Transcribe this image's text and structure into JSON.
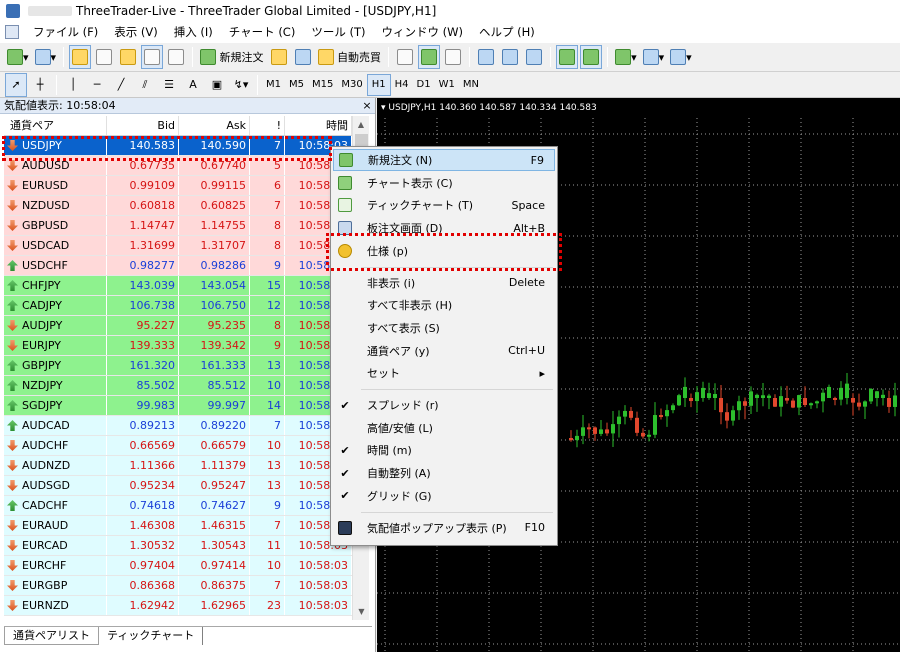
{
  "window": {
    "title": "ThreeTrader-Live - ThreeTrader Global Limited - [USDJPY,H1]"
  },
  "menu": [
    "ファイル (F)",
    "表示 (V)",
    "挿入 (I)",
    "チャート (C)",
    "ツール (T)",
    "ウィンドウ (W)",
    "ヘルプ (H)"
  ],
  "toolbar1": {
    "new_order": "新規注文",
    "auto_trade": "自動売買"
  },
  "toolbar2": {
    "text_tool": "A",
    "timeframes": [
      "M1",
      "M5",
      "M15",
      "M30",
      "H1",
      "H4",
      "D1",
      "W1",
      "MN"
    ],
    "active_timeframe": "H1"
  },
  "market_watch": {
    "header": "気配値表示: 10:58:04",
    "columns": {
      "symbol": "通貨ペア",
      "bid": "Bid",
      "ask": "Ask",
      "spread": "!",
      "time": "時間"
    },
    "rows": [
      {
        "symbol": "USDJPY",
        "bid": "140.583",
        "ask": "140.590",
        "spread": "7",
        "time": "10:58:03",
        "dir": "down",
        "bg": "sel",
        "vc": "blue"
      },
      {
        "symbol": "AUDUSD",
        "bid": "0.67735",
        "ask": "0.67740",
        "spread": "5",
        "time": "10:58:03",
        "dir": "down",
        "bg": "red",
        "vc": "red"
      },
      {
        "symbol": "EURUSD",
        "bid": "0.99109",
        "ask": "0.99115",
        "spread": "6",
        "time": "10:58:03",
        "dir": "down",
        "bg": "red",
        "vc": "red"
      },
      {
        "symbol": "NZDUSD",
        "bid": "0.60818",
        "ask": "0.60825",
        "spread": "7",
        "time": "10:58:03",
        "dir": "down",
        "bg": "red",
        "vc": "red"
      },
      {
        "symbol": "GBPUSD",
        "bid": "1.14747",
        "ask": "1.14755",
        "spread": "8",
        "time": "10:58:03",
        "dir": "down",
        "bg": "red",
        "vc": "red"
      },
      {
        "symbol": "USDCAD",
        "bid": "1.31699",
        "ask": "1.31707",
        "spread": "8",
        "time": "10:58:03",
        "dir": "down",
        "bg": "red",
        "vc": "red"
      },
      {
        "symbol": "USDCHF",
        "bid": "0.98277",
        "ask": "0.98286",
        "spread": "9",
        "time": "10:58:03",
        "dir": "up",
        "bg": "red",
        "vc": "blue"
      },
      {
        "symbol": "CHFJPY",
        "bid": "143.039",
        "ask": "143.054",
        "spread": "15",
        "time": "10:58:03",
        "dir": "up",
        "bg": "green",
        "vc": "blue"
      },
      {
        "symbol": "CADJPY",
        "bid": "106.738",
        "ask": "106.750",
        "spread": "12",
        "time": "10:58:03",
        "dir": "up",
        "bg": "green",
        "vc": "blue"
      },
      {
        "symbol": "AUDJPY",
        "bid": "95.227",
        "ask": "95.235",
        "spread": "8",
        "time": "10:58:03",
        "dir": "down",
        "bg": "green",
        "vc": "red"
      },
      {
        "symbol": "EURJPY",
        "bid": "139.333",
        "ask": "139.342",
        "spread": "9",
        "time": "10:58:03",
        "dir": "down",
        "bg": "green",
        "vc": "red"
      },
      {
        "symbol": "GBPJPY",
        "bid": "161.320",
        "ask": "161.333",
        "spread": "13",
        "time": "10:58:03",
        "dir": "up",
        "bg": "green",
        "vc": "blue"
      },
      {
        "symbol": "NZDJPY",
        "bid": "85.502",
        "ask": "85.512",
        "spread": "10",
        "time": "10:58:03",
        "dir": "up",
        "bg": "green",
        "vc": "blue"
      },
      {
        "symbol": "SGDJPY",
        "bid": "99.983",
        "ask": "99.997",
        "spread": "14",
        "time": "10:58:03",
        "dir": "up",
        "bg": "green",
        "vc": "blue"
      },
      {
        "symbol": "AUDCAD",
        "bid": "0.89213",
        "ask": "0.89220",
        "spread": "7",
        "time": "10:58:03",
        "dir": "up",
        "bg": "cyan",
        "vc": "blue"
      },
      {
        "symbol": "AUDCHF",
        "bid": "0.66569",
        "ask": "0.66579",
        "spread": "10",
        "time": "10:58:03",
        "dir": "down",
        "bg": "cyan",
        "vc": "red"
      },
      {
        "symbol": "AUDNZD",
        "bid": "1.11366",
        "ask": "1.11379",
        "spread": "13",
        "time": "10:58:03",
        "dir": "down",
        "bg": "cyan",
        "vc": "red"
      },
      {
        "symbol": "AUDSGD",
        "bid": "0.95234",
        "ask": "0.95247",
        "spread": "13",
        "time": "10:58:03",
        "dir": "down",
        "bg": "cyan",
        "vc": "red"
      },
      {
        "symbol": "CADCHF",
        "bid": "0.74618",
        "ask": "0.74627",
        "spread": "9",
        "time": "10:58:03",
        "dir": "up",
        "bg": "cyan",
        "vc": "blue"
      },
      {
        "symbol": "EURAUD",
        "bid": "1.46308",
        "ask": "1.46315",
        "spread": "7",
        "time": "10:58:03",
        "dir": "down",
        "bg": "cyan",
        "vc": "red"
      },
      {
        "symbol": "EURCAD",
        "bid": "1.30532",
        "ask": "1.30543",
        "spread": "11",
        "time": "10:58:03",
        "dir": "down",
        "bg": "cyan",
        "vc": "red"
      },
      {
        "symbol": "EURCHF",
        "bid": "0.97404",
        "ask": "0.97414",
        "spread": "10",
        "time": "10:58:03",
        "dir": "down",
        "bg": "cyan",
        "vc": "red"
      },
      {
        "symbol": "EURGBP",
        "bid": "0.86368",
        "ask": "0.86375",
        "spread": "7",
        "time": "10:58:03",
        "dir": "down",
        "bg": "cyan",
        "vc": "red"
      },
      {
        "symbol": "EURNZD",
        "bid": "1.62942",
        "ask": "1.62965",
        "spread": "23",
        "time": "10:58:03",
        "dir": "down",
        "bg": "cyan",
        "vc": "red"
      }
    ],
    "tabs": [
      "通貨ペアリスト",
      "ティックチャート"
    ]
  },
  "chart": {
    "title": "USDJPY,H1  140.360 140.587 140.334 140.583",
    "colors": {
      "bg": "#000000",
      "grid": "#9a9a9a",
      "bull": "#2dbf2d",
      "bear": "#e2482d"
    }
  },
  "context_menu": {
    "items": [
      {
        "icon": "new-order-icon",
        "label": "新規注文 (N)",
        "shortcut": "F9",
        "hover": true
      },
      {
        "icon": "chart-window-icon",
        "label": "チャート表示 (C)",
        "shortcut": ""
      },
      {
        "icon": "tick-chart-icon",
        "label": "ティックチャート (T)",
        "shortcut": "Space"
      },
      {
        "icon": "depth-of-market-icon",
        "label": "板注文画面 (D)",
        "shortcut": "Alt+B"
      },
      {
        "icon": "specification-icon",
        "label": "仕様 (p)",
        "shortcut": ""
      },
      {
        "sep": true
      },
      {
        "icon": "",
        "label": "非表示 (i)",
        "shortcut": "Delete"
      },
      {
        "icon": "",
        "label": "すべて非表示 (H)",
        "shortcut": ""
      },
      {
        "icon": "",
        "label": "すべて表示 (S)",
        "shortcut": ""
      },
      {
        "icon": "",
        "label": "通貨ペア (y)",
        "shortcut": "Ctrl+U"
      },
      {
        "icon": "",
        "label": "セット",
        "shortcut": "▸"
      },
      {
        "sep": true
      },
      {
        "icon": "check-icon",
        "label": "スプレッド (r)",
        "shortcut": ""
      },
      {
        "icon": "",
        "label": "高値/安値 (L)",
        "shortcut": ""
      },
      {
        "icon": "check-icon",
        "label": "時間 (m)",
        "shortcut": ""
      },
      {
        "icon": "check-icon",
        "label": "自動整列 (A)",
        "shortcut": ""
      },
      {
        "icon": "check-icon",
        "label": "グリッド (G)",
        "shortcut": ""
      },
      {
        "sep": true
      },
      {
        "icon": "popup-prices-icon",
        "label": "気配値ポップアップ表示 (P)",
        "shortcut": "F10"
      }
    ]
  },
  "highlight_color": "#e10000"
}
